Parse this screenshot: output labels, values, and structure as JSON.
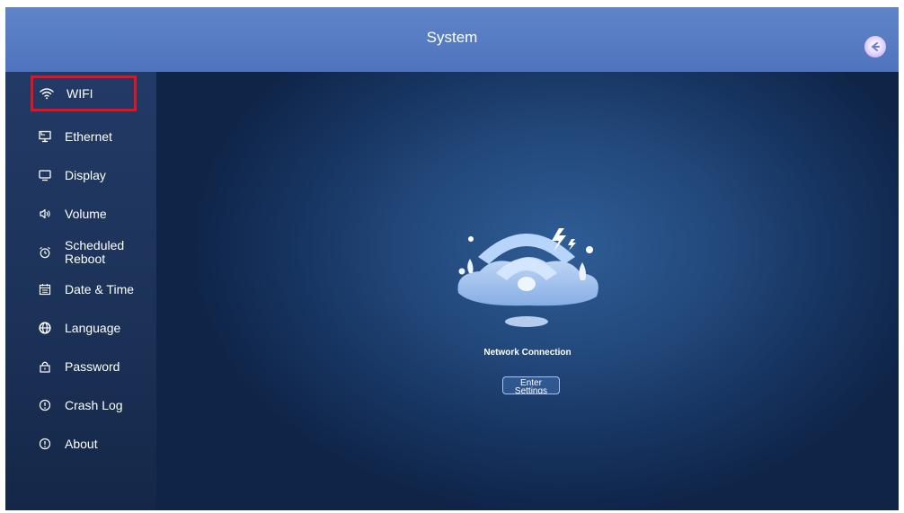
{
  "header": {
    "title": "System",
    "back_icon": "back-arrow-icon"
  },
  "sidebar": {
    "items": [
      {
        "label": "WIFI",
        "icon": "wifi-icon",
        "selected": true
      },
      {
        "label": "Ethernet",
        "icon": "ethernet-icon"
      },
      {
        "label": "Display",
        "icon": "monitor-icon"
      },
      {
        "label": "Volume",
        "icon": "speaker-icon"
      },
      {
        "label": "Scheduled Reboot",
        "icon": "alarm-clock-icon"
      },
      {
        "label": "Date & Time",
        "icon": "calendar-icon"
      },
      {
        "label": "Language",
        "icon": "globe-icon"
      },
      {
        "label": "Password",
        "icon": "lock-icon"
      },
      {
        "label": "Crash Log",
        "icon": "info-circle-icon"
      },
      {
        "label": "About",
        "icon": "info-circle-icon"
      }
    ]
  },
  "main": {
    "illustration_icon": "wifi-cloud-illustration",
    "network_label": "Network Connection",
    "enter_button_label": "Enter Settings"
  },
  "colors": {
    "header": "#5a7fc4",
    "sidebar": "#1e355f",
    "main_background": "#23497c",
    "highlight": "#e0141f"
  }
}
